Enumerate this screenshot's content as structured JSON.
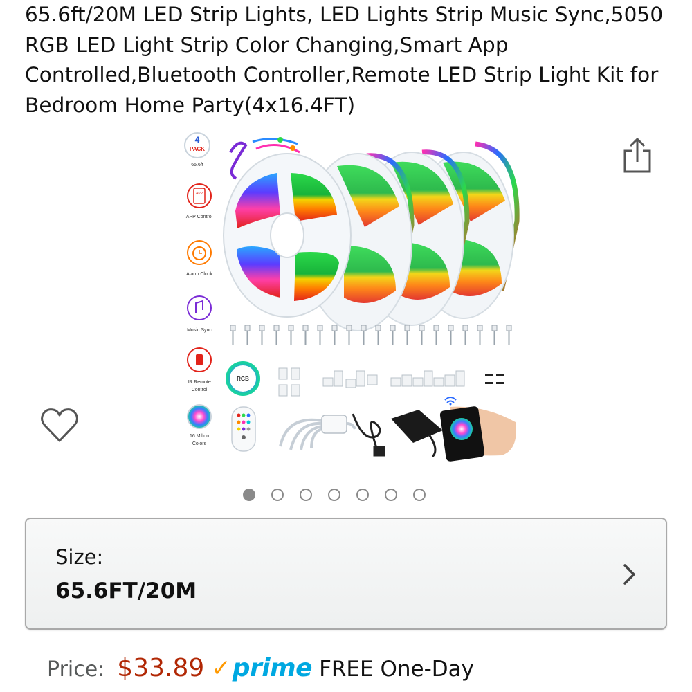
{
  "product": {
    "title": "65.6ft/20M LED Strip Lights, LED Lights Strip Music Sync,5050 RGB LED Light Strip Color Changing,Smart App Controlled,Bluetooth Controller,Remote LED Strip Light Kit for Bedroom Home Party(4x16.4FT)"
  },
  "image_labels": {
    "pack_number": "4",
    "pack_word": "PACK",
    "pack_length": "65.6ft",
    "app_control": "APP Control",
    "alarm_clock": "Alarm Clock",
    "music_sync": "Music Sync",
    "ir_remote_line1": "IR Remote",
    "ir_remote_line2": "Control",
    "colors_line1": "16 Milion",
    "colors_line2": "Colors",
    "rgb": "RGB",
    "app_badge": "APP"
  },
  "carousel": {
    "count": 7,
    "active_index": 0
  },
  "size_selector": {
    "label": "Size:",
    "value": "65.6FT/20M"
  },
  "price": {
    "label": "Price:",
    "value": "$33.89",
    "prime_check": "✓",
    "prime_word": "prime",
    "delivery": "FREE One-Day"
  },
  "icons": {
    "share": "share-icon",
    "wishlist": "heart-icon",
    "chevron": "chevron-right-icon"
  },
  "colors": {
    "price": "#B12704",
    "prime_blue": "#00A8E1",
    "prime_orange": "#FF9900",
    "dot": "#8a8a8a"
  }
}
